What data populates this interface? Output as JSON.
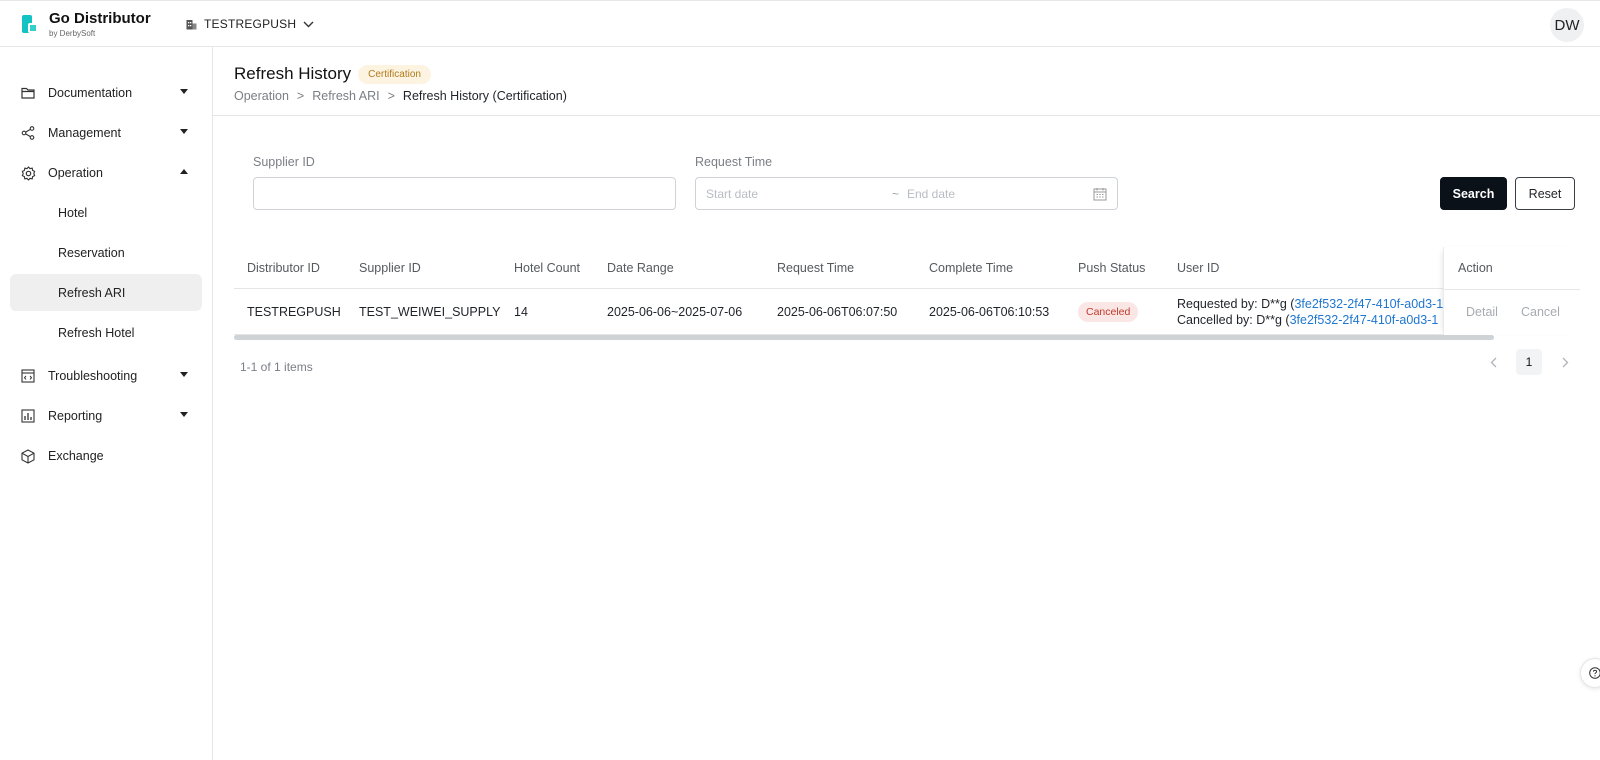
{
  "app": {
    "title": "Go Distributor",
    "subtitle": "by DerbySoft",
    "tenant": "TESTREGPUSH",
    "avatar": "DW",
    "accent_color": "#13c2c2"
  },
  "sidebar": {
    "items": [
      {
        "label": "Documentation",
        "icon": "folder-icon"
      },
      {
        "label": "Management",
        "icon": "share-icon"
      },
      {
        "label": "Operation",
        "icon": "gear-icon"
      },
      {
        "label": "Troubleshooting",
        "icon": "code-window-icon"
      },
      {
        "label": "Reporting",
        "icon": "bar-chart-icon"
      },
      {
        "label": "Exchange",
        "icon": "cube-icon"
      }
    ],
    "operation_children": [
      "Hotel",
      "Reservation",
      "Refresh ARI",
      "Refresh Hotel"
    ],
    "active_child": "Refresh ARI"
  },
  "page": {
    "title": "Refresh History",
    "tag": "Certification",
    "breadcrumb": [
      "Operation",
      ">",
      "Refresh ARI",
      ">",
      "Refresh History (Certification)"
    ]
  },
  "filters": {
    "supplier_label": "Supplier ID",
    "supplier_value": "",
    "request_time_label": "Request Time",
    "start_placeholder": "Start date",
    "separator": "~",
    "end_placeholder": "End date",
    "search_label": "Search",
    "reset_label": "Reset"
  },
  "table": {
    "columns": [
      "Distributor ID",
      "Supplier ID",
      "Hotel Count",
      "Date Range",
      "Request Time",
      "Complete Time",
      "Push Status",
      "User ID",
      "Action"
    ],
    "rows": [
      {
        "distributor_id": "TESTREGPUSH",
        "supplier_id": "TEST_WEIWEI_SUPPLY",
        "hotel_count": "14",
        "date_range": "2025-06-06~2025-07-06",
        "request_time": "2025-06-06T06:07:50",
        "complete_time": "2025-06-06T06:10:53",
        "push_status": "Canceled",
        "requested_by_prefix": "Requested by: D**g (",
        "requested_by_link": "3fe2f532-2f47-410f-a0d3-1",
        "cancelled_by_prefix": "Cancelled by: D**g (",
        "cancelled_by_link": "3fe2f532-2f47-410f-a0d3-1",
        "actions": [
          "Detail",
          "Cancel"
        ]
      }
    ]
  },
  "pagination": {
    "summary": "1-1 of 1 items",
    "current_page": "1"
  }
}
